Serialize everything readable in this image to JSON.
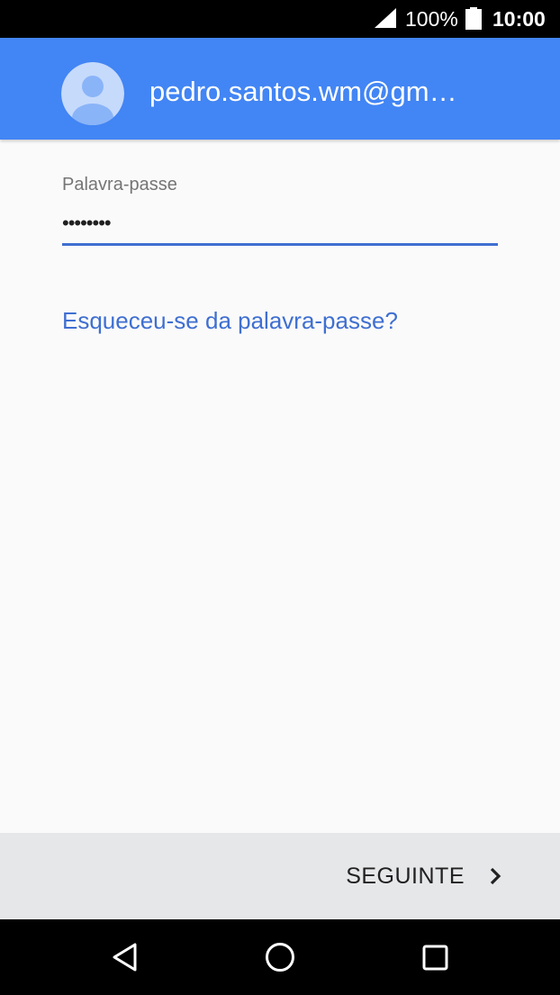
{
  "status_bar": {
    "battery_percent": "100%",
    "time": "10:00",
    "icons": [
      "signal-icon",
      "battery-icon"
    ]
  },
  "header": {
    "email": "pedro.santos.wm@gm…",
    "avatar_icon": "account-circle-icon",
    "background_color": "#4285f4"
  },
  "password_field": {
    "label": "Palavra-passe",
    "masked_value": "••••••••",
    "accent_color": "#3f6fd1"
  },
  "forgot_password": {
    "label": "Esqueceu-se da palavra-passe?"
  },
  "footer": {
    "next_label": "SEGUINTE",
    "next_icon": "chevron-right-icon"
  },
  "nav_bar": {
    "icons": [
      "back-icon",
      "home-icon",
      "recents-icon"
    ]
  }
}
